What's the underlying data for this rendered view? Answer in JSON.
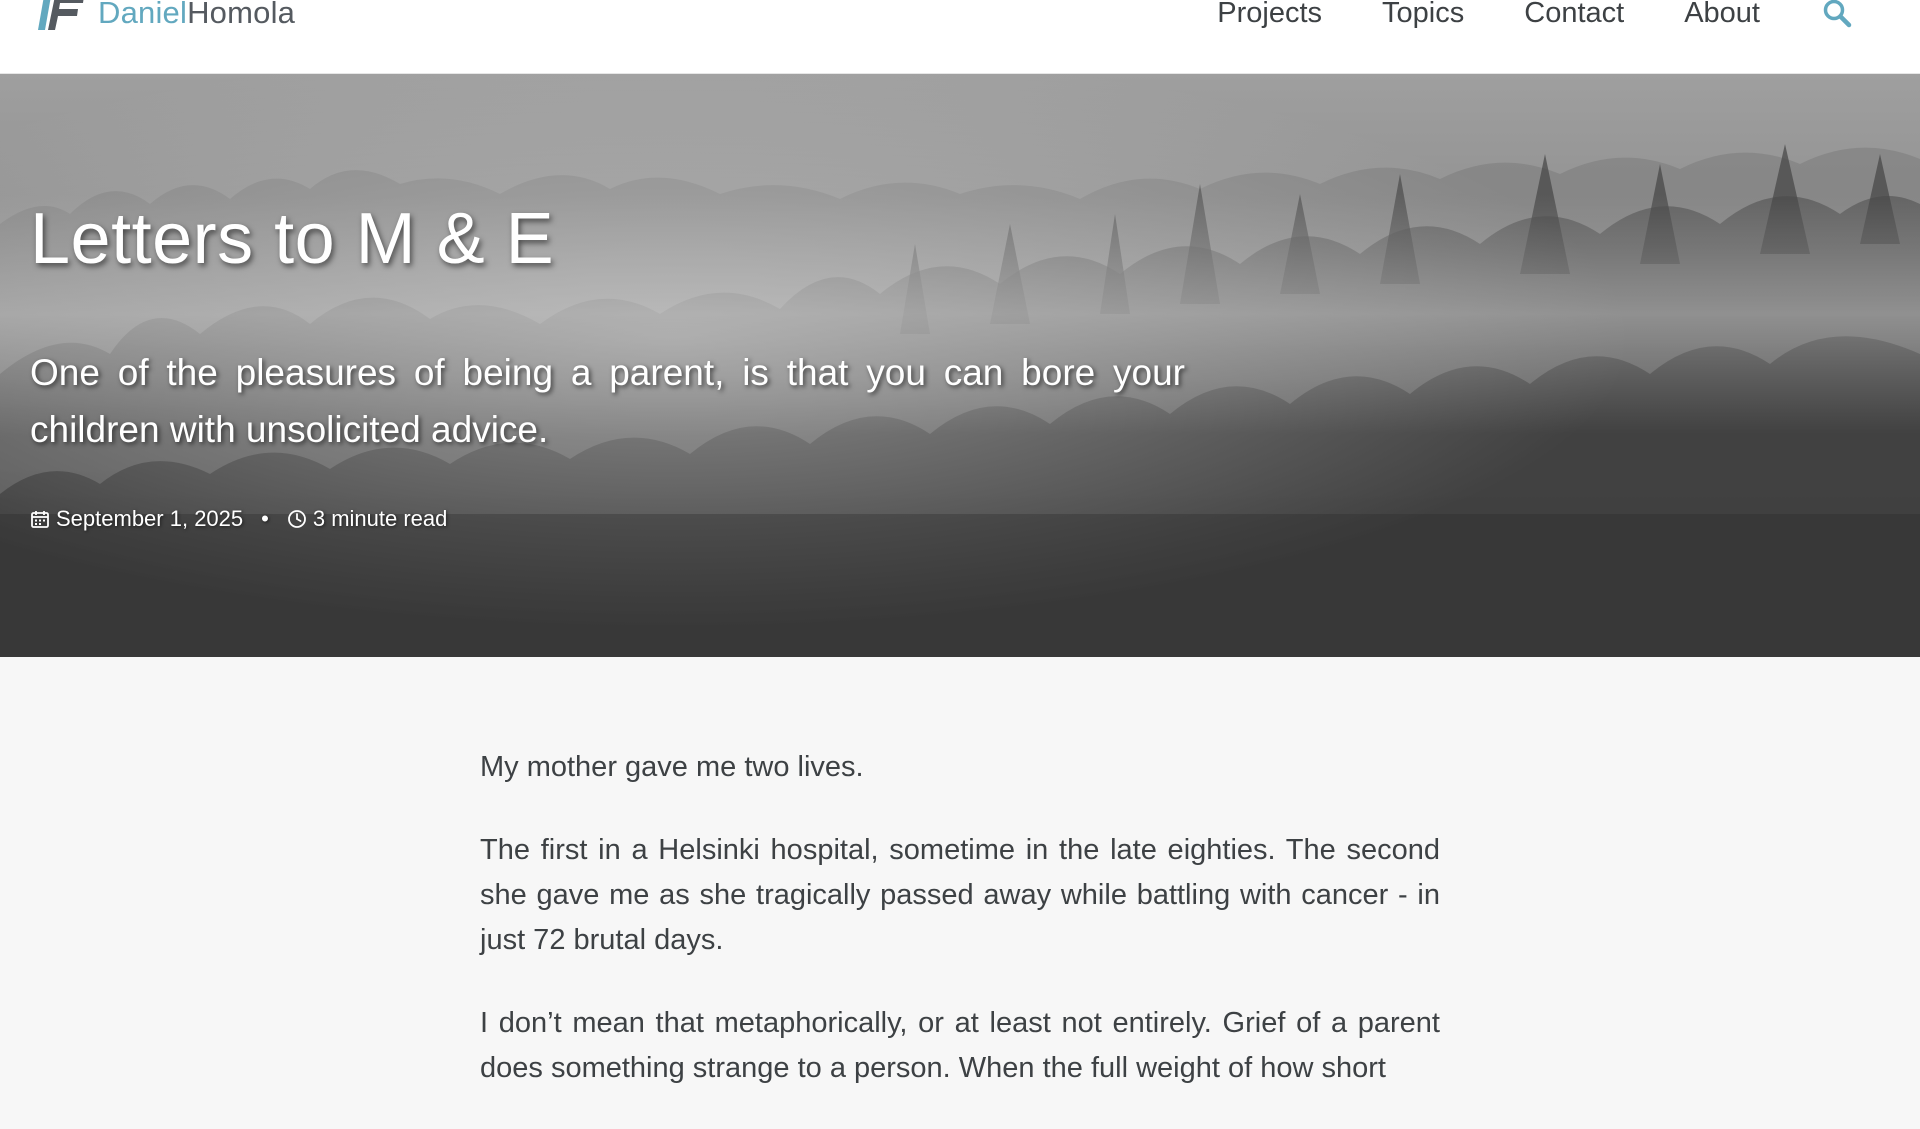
{
  "masthead": {
    "brand": {
      "logo_icon": "df-logo-icon",
      "first_name": "Daniel",
      "last_name": "Homola"
    },
    "nav": [
      {
        "label": "Projects"
      },
      {
        "label": "Topics"
      },
      {
        "label": "Contact"
      },
      {
        "label": "About"
      }
    ],
    "search_icon": "search-icon"
  },
  "hero": {
    "title": "Letters to M & E",
    "excerpt": "One of the pleasures of being a parent, is that you can bore your children with unsolicited advice.",
    "meta": {
      "date_icon": "calendar-icon",
      "date": "September 1, 2025",
      "separator": "•",
      "read_icon": "clock-icon",
      "read_time": "3 minute read"
    }
  },
  "article": {
    "paragraphs": [
      "My mother gave me two lives.",
      "The first in a Helsinki hospital, sometime in the late eighties. The second she gave me as she tragically passed away while battling with cancer - in just 72 brutal days.",
      "I don’t mean that metaphorically, or at least not entirely. Grief of a parent does something strange to a person. When the full weight of how short"
    ]
  },
  "colors": {
    "brand_accent": "#62a8bf",
    "text_dark": "#3d4144",
    "page_bg": "#f7f7f7"
  }
}
